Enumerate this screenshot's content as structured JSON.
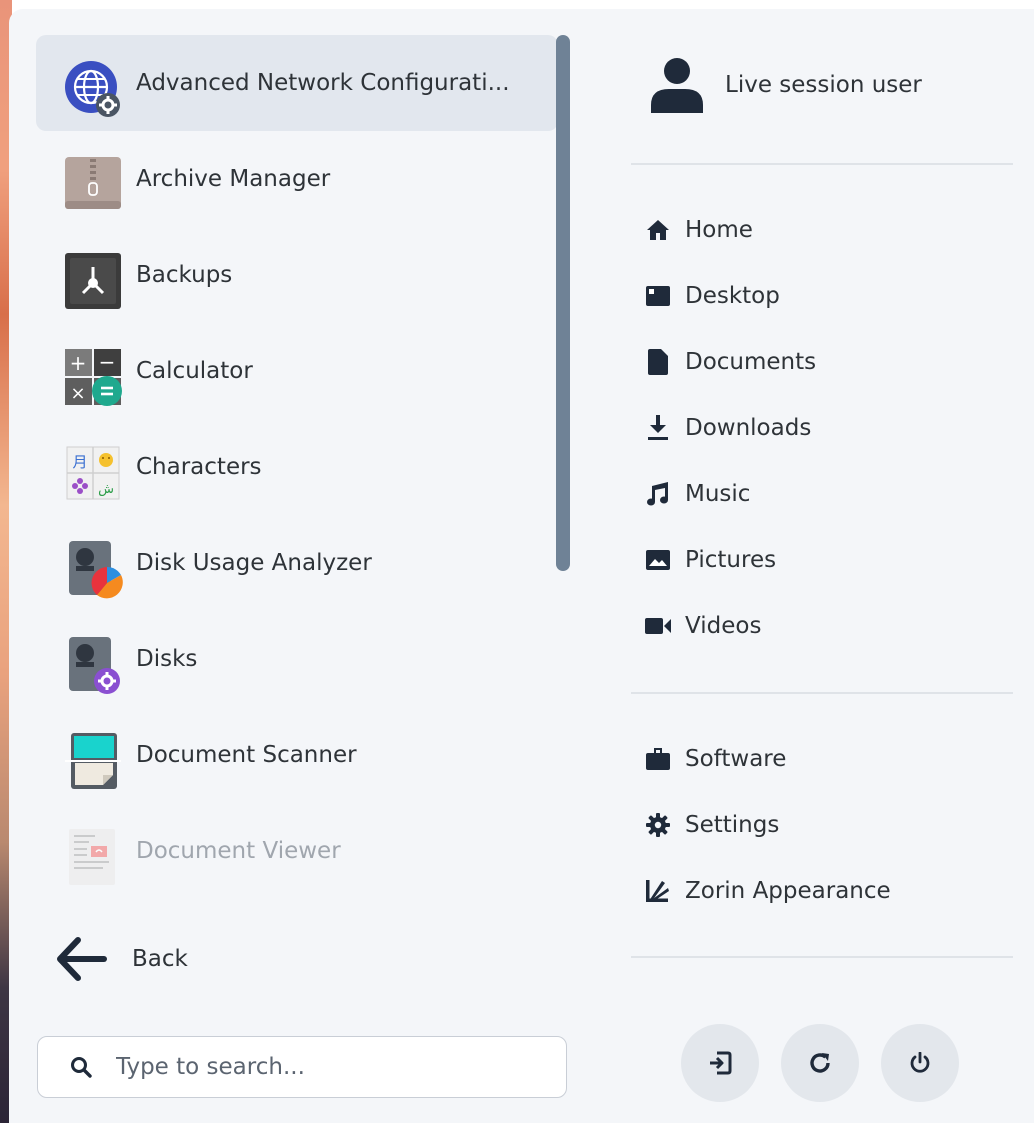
{
  "apps": [
    {
      "label": "Advanced Network Configurati...",
      "icon": "network-config-icon",
      "state": "selected"
    },
    {
      "label": "Archive Manager",
      "icon": "archive-manager-icon",
      "state": "normal"
    },
    {
      "label": "Backups",
      "icon": "backups-icon",
      "state": "normal"
    },
    {
      "label": "Calculator",
      "icon": "calculator-icon",
      "state": "normal"
    },
    {
      "label": "Characters",
      "icon": "characters-icon",
      "state": "normal"
    },
    {
      "label": "Disk Usage Analyzer",
      "icon": "disk-usage-analyzer-icon",
      "state": "normal"
    },
    {
      "label": "Disks",
      "icon": "disks-icon",
      "state": "normal"
    },
    {
      "label": "Document Scanner",
      "icon": "document-scanner-icon",
      "state": "normal"
    },
    {
      "label": "Document Viewer",
      "icon": "document-viewer-icon",
      "state": "dimmed"
    }
  ],
  "back": {
    "label": "Back",
    "icon": "arrow-left-icon"
  },
  "search": {
    "placeholder": "Type to search...",
    "value": "",
    "icon": "search-icon"
  },
  "user": {
    "name": "Live session user",
    "icon": "user-avatar-icon"
  },
  "places": [
    {
      "label": "Home",
      "icon": "home-icon"
    },
    {
      "label": "Desktop",
      "icon": "desktop-icon"
    },
    {
      "label": "Documents",
      "icon": "documents-icon"
    },
    {
      "label": "Downloads",
      "icon": "downloads-icon"
    },
    {
      "label": "Music",
      "icon": "music-icon"
    },
    {
      "label": "Pictures",
      "icon": "pictures-icon"
    },
    {
      "label": "Videos",
      "icon": "videos-icon"
    }
  ],
  "system": [
    {
      "label": "Software",
      "icon": "software-icon"
    },
    {
      "label": "Settings",
      "icon": "settings-icon"
    },
    {
      "label": "Zorin Appearance",
      "icon": "zorin-appearance-icon"
    }
  ],
  "power_buttons": [
    {
      "icon": "log-out-icon",
      "action": "log-out"
    },
    {
      "icon": "restart-icon",
      "action": "restart"
    },
    {
      "icon": "power-off-icon",
      "action": "power-off"
    }
  ],
  "colors": {
    "menu_bg": "#f4f6f9",
    "selected_row": "#e2e7ee",
    "scrollbar": "#6f8296",
    "text": "#2e3338",
    "dim_text": "#a0a6ae",
    "icon_dark": "#1f2a3a"
  }
}
